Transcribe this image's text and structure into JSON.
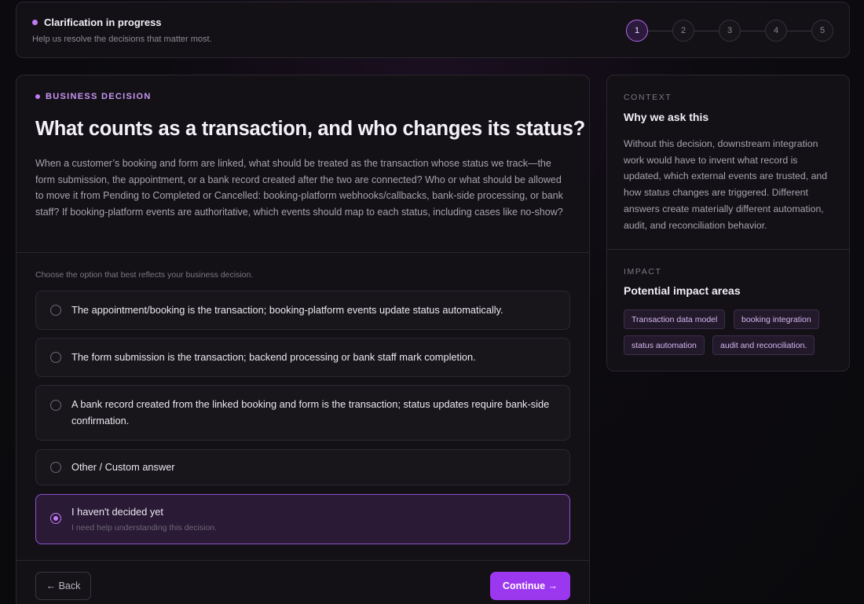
{
  "header": {
    "status_title": "Clarification in progress",
    "status_subtitle": "Help us resolve the decisions that matter most.",
    "steps": [
      "1",
      "2",
      "3",
      "4",
      "5"
    ],
    "active_step": 1
  },
  "question_card": {
    "tag": "BUSINESS DECISION",
    "title": "What counts as a transaction, and who changes its status?",
    "description": "When a customer’s booking and form are linked, what should be treated as the transaction whose status we track—the form submission, the appointment, or a bank record created after the two are connected? Who or what should be allowed to move it from Pending to Completed or Cancelled: booking-platform webhooks/callbacks, bank-side processing, or bank staff? If booking-platform events are authoritative, which events should map to each status, including cases like no-show?",
    "hint": "Choose the option that best reflects your business decision.",
    "options": [
      {
        "label": "The appointment/booking is the transaction; booking-platform events update status automatically.",
        "selected": false
      },
      {
        "label": "The form submission is the transaction; backend processing or bank staff mark completion.",
        "selected": false
      },
      {
        "label": "A bank record created from the linked booking and form is the transaction; status updates require bank-side confirmation.",
        "selected": false
      },
      {
        "label": "Other / Custom answer",
        "selected": false
      },
      {
        "label": "I haven't decided yet",
        "sublabel": "I need help understanding this decision.",
        "selected": true
      }
    ],
    "back_label": "← Back",
    "continue_label": "Continue →"
  },
  "sidebar": {
    "context_caption": "CONTEXT",
    "context_title": "Why we ask this",
    "context_body": "Without this decision, downstream integration work would have to invent what record is updated, which external events are trusted, and how status changes are triggered. Different answers create materially different automation, audit, and reconciliation behavior.",
    "impact_caption": "IMPACT",
    "impact_title": "Potential impact areas",
    "impact_tags": [
      "Transaction data model",
      "booking integration",
      "status automation",
      "audit and reconciliation."
    ]
  },
  "colors": {
    "accent": "#9c37f0",
    "accent_light": "#c27af5",
    "background": "#0a090c",
    "card": "#131116"
  }
}
